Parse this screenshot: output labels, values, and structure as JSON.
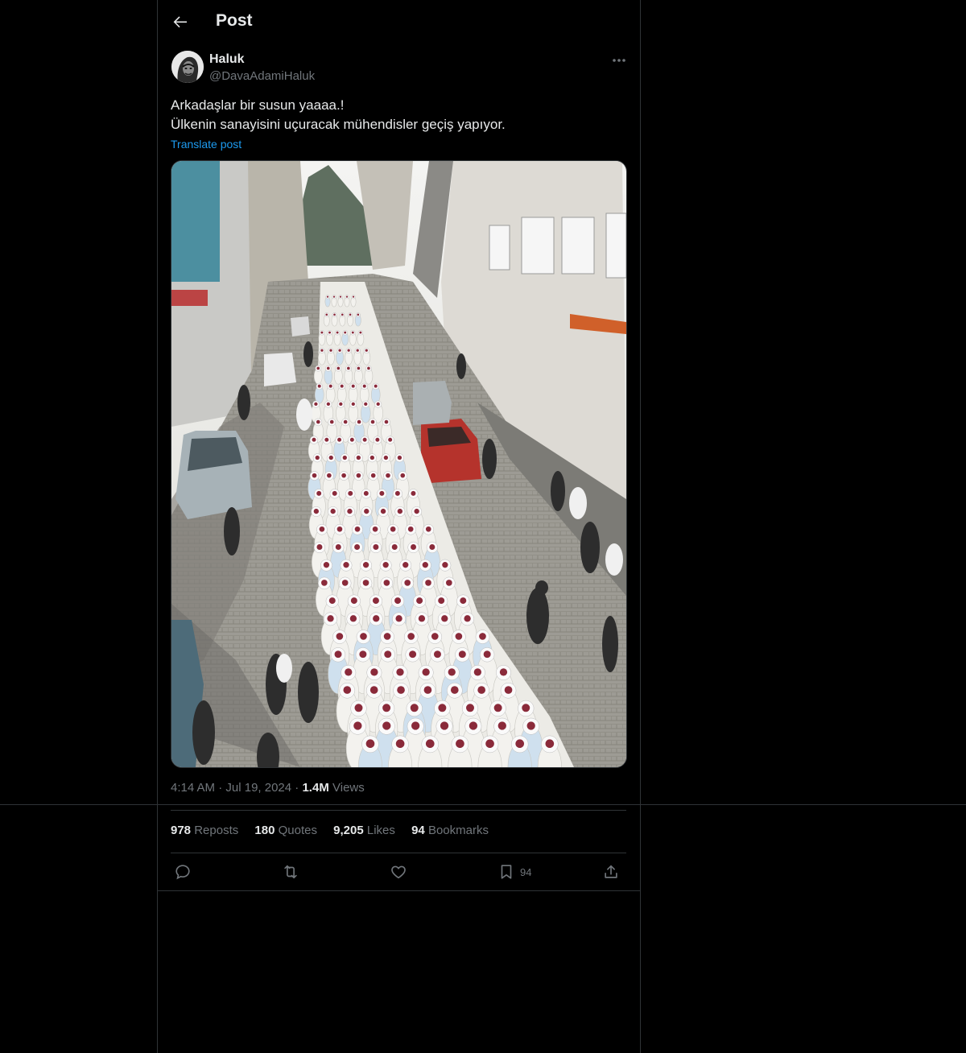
{
  "header": {
    "title": "Post"
  },
  "post": {
    "author_name": "Haluk",
    "author_handle": "@DavaAdamiHaluk",
    "text_line1": "Arkadaşlar bir susun yaaaa.!",
    "text_line2": "Ülkenin sanayisini uçuracak mühendisler geçiş yapıyor.",
    "translate_label": "Translate post",
    "time": "4:14 AM",
    "date": "Jul 19, 2024",
    "views_count": "1.4M",
    "views_label": "Views",
    "separator": "·"
  },
  "stats": {
    "reposts_count": "978",
    "reposts_label": "Reposts",
    "quotes_count": "180",
    "quotes_label": "Quotes",
    "likes_count": "9,205",
    "likes_label": "Likes",
    "bookmarks_count": "94",
    "bookmarks_label": "Bookmarks"
  },
  "actions": {
    "bookmark_count": "94"
  },
  "icons": {
    "back": "arrow-left-icon",
    "more": "more-horizontal-icon",
    "reply": "reply-icon",
    "repost": "repost-icon",
    "like": "heart-icon",
    "bookmark": "bookmark-icon",
    "share": "share-icon"
  },
  "colors": {
    "background": "#000000",
    "text": "#e7e9ea",
    "muted": "#71767b",
    "accent": "#1d9bf0",
    "border": "#2f3336"
  }
}
